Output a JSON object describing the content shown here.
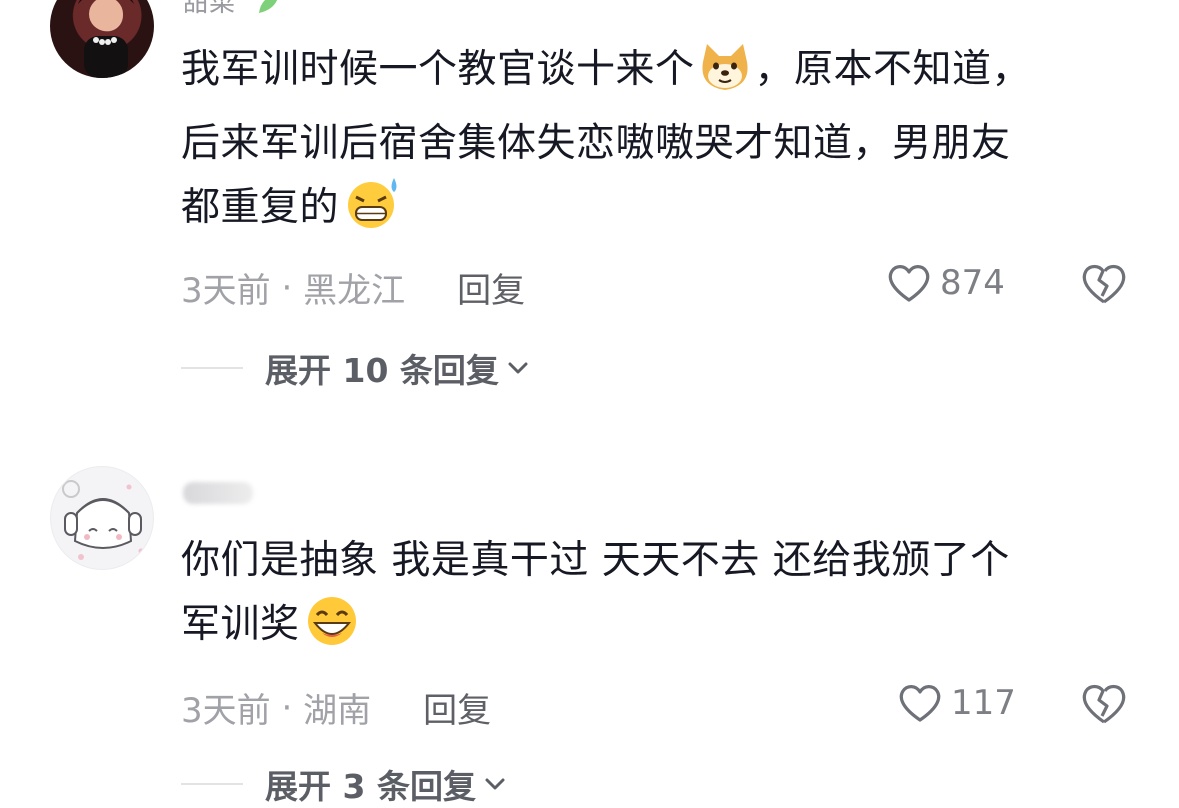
{
  "comments": [
    {
      "username": "甜菜",
      "text_line1_a": "我军训时候一个教官谈十来个",
      "text_line1_b": "，原本不知道，",
      "text_line2": "后来军训后宿舍集体失恋嗷嗷哭才知道，男朋友",
      "text_line3": "都重复的",
      "time": "3天前",
      "location": "黑龙江",
      "reply_label": "回复",
      "likes": "874",
      "expand_label": "展开 10 条回复"
    },
    {
      "username": "",
      "text_line1": "你们是抽象 我是真干过 天天不去 还给我颁了个",
      "text_line2": "军训奖",
      "time": "3天前",
      "location": "湖南",
      "reply_label": "回复",
      "likes": "117",
      "expand_label": "展开 3 条回复"
    }
  ],
  "meta_separator": " · ",
  "icons": [
    "doge-emoji",
    "sweat-grin-emoji",
    "grin-emoji",
    "heart-outline-icon",
    "broken-heart-icon",
    "chevron-down-icon"
  ]
}
